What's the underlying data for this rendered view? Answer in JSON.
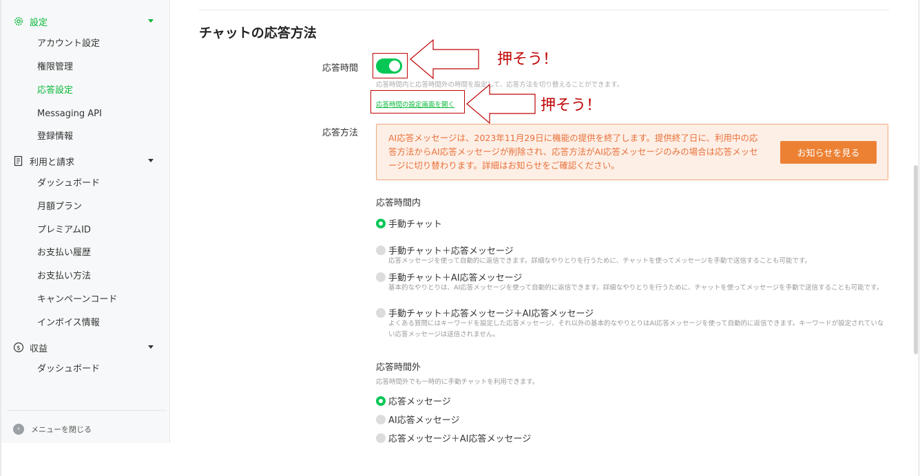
{
  "sidebar": {
    "groups": [
      {
        "label": "設定",
        "icon": "gear-icon",
        "items": [
          "アカウント設定",
          "権限管理",
          "応答設定",
          "Messaging API",
          "登録情報"
        ]
      },
      {
        "label": "利用と請求",
        "icon": "document-icon",
        "items": [
          "ダッシュボード",
          "月額プラン",
          "プレミアムID",
          "お支払い履歴",
          "お支払い方法",
          "キャンペーンコード",
          "インボイス情報"
        ]
      },
      {
        "label": "収益",
        "icon": "dollar-icon",
        "items": [
          "ダッシュボード"
        ]
      }
    ],
    "active_item": "応答設定",
    "close_menu_label": "メニューを閉じる"
  },
  "main": {
    "title": "チャットの応答方法",
    "response_time": {
      "label": "応答時間",
      "toggle_on": true,
      "hint": "応答時間内と応答時間外の時間を設定して、応答方法を切り替えることができます。",
      "link": "応答時間の設定画面を開く"
    },
    "response_method": {
      "label": "応答方法",
      "alert_text": "AI応答メッセージは、2023年11月29日に機能の提供を終了します。提供終了日に、利用中の応答方法からAI応答メッセージが削除され、応答方法がAI応答メッセージのみの場合は応答メッセージに切り替わります。詳細はお知らせをご確認ください。",
      "alert_button": "お知らせを見る"
    },
    "within_hours": {
      "title": "応答時間内",
      "options": [
        {
          "label": "手動チャット",
          "checked": true,
          "desc": ""
        },
        {
          "label": "手動チャット＋応答メッセージ",
          "checked": false,
          "desc": "応答メッセージを使って自動的に返信できます。詳細なやりとりを行うために、チャットを使ってメッセージを手動で送信することも可能です。"
        },
        {
          "label": "手動チャット＋AI応答メッセージ",
          "checked": false,
          "desc": "基本的なやりとりは、AI応答メッセージを使って自動的に返信できます。詳細なやりとりを行うために、チャットを使ってメッセージを手動で送信することも可能です。"
        },
        {
          "label": "手動チャット＋応答メッセージ＋AI応答メッセージ",
          "checked": false,
          "desc": "よくある質問にはキーワードを設定した応答メッセージ、それ以外の基本的なやりとりはAI応答メッセージを使って自動的に返信できます。キーワードが設定されていない応答メッセージは送信されません。"
        }
      ]
    },
    "outside_hours": {
      "title": "応答時間外",
      "desc": "応答時間外でも一時的に手動チャットを利用できます。",
      "options": [
        {
          "label": "応答メッセージ",
          "checked": true
        },
        {
          "label": "AI応答メッセージ",
          "checked": false
        },
        {
          "label": "応答メッセージ＋AI応答メッセージ",
          "checked": false
        }
      ]
    }
  },
  "annotations": {
    "push_label_1": "押そう！",
    "push_label_2": "押そう！",
    "color": "#c00000"
  },
  "colors": {
    "accent": "#06c755",
    "alert_text": "#e8703a",
    "alert_button": "#ec8134"
  }
}
